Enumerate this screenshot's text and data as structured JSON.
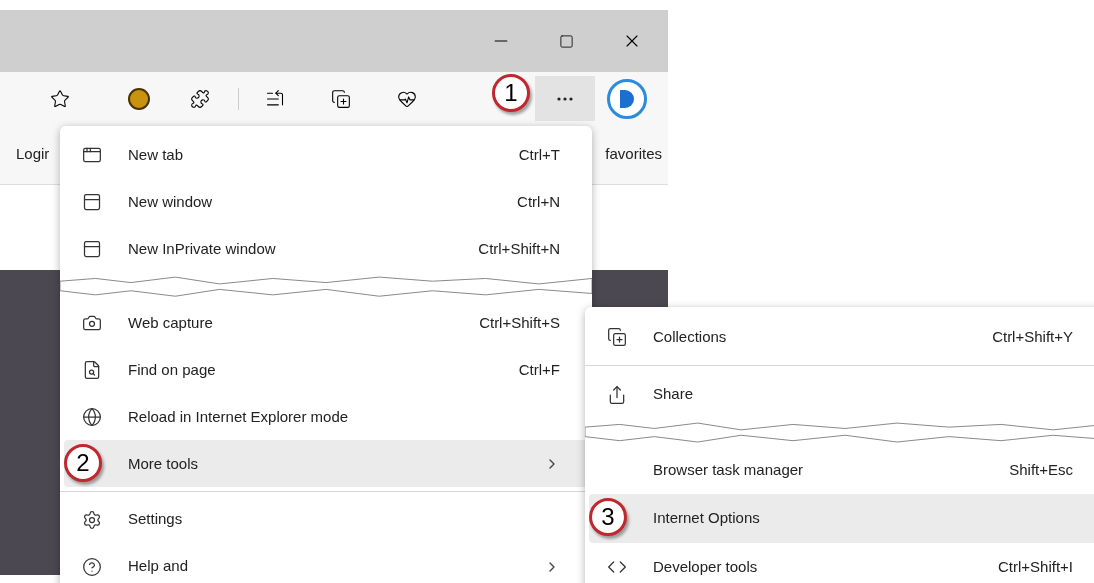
{
  "toolbar": {
    "callout": "1"
  },
  "favorites_bar": {
    "left": "Logir",
    "right": "favorites"
  },
  "main_menu": {
    "items": [
      {
        "kind": "item",
        "label": "New tab",
        "shortcut": "Ctrl+T",
        "selected": false,
        "submenu": false
      },
      {
        "kind": "item",
        "label": "New window",
        "shortcut": "Ctrl+N",
        "selected": false,
        "submenu": false
      },
      {
        "kind": "item",
        "label": "New InPrivate window",
        "shortcut": "Ctrl+Shift+N",
        "selected": false,
        "submenu": false
      },
      {
        "kind": "tear"
      },
      {
        "kind": "item",
        "label": "Web capture",
        "shortcut": "Ctrl+Shift+S",
        "selected": false,
        "submenu": false
      },
      {
        "kind": "item",
        "label": "Find on page",
        "shortcut": "Ctrl+F",
        "selected": false,
        "submenu": false
      },
      {
        "kind": "item",
        "label": "Reload in Internet Explorer mode",
        "selected": false,
        "submenu": false
      },
      {
        "kind": "item",
        "label": "More tools",
        "selected": true,
        "submenu": true,
        "callout": "2"
      },
      {
        "kind": "divider"
      },
      {
        "kind": "item",
        "label": "Settings",
        "selected": false,
        "submenu": false
      },
      {
        "kind": "item",
        "label": "Help and",
        "selected": false,
        "submenu": true
      }
    ]
  },
  "submenu": {
    "items": [
      {
        "kind": "item",
        "label": "Collections",
        "shortcut": "Ctrl+Shift+Y",
        "selected": false
      },
      {
        "kind": "divider"
      },
      {
        "kind": "item",
        "label": "Share",
        "selected": false
      },
      {
        "kind": "tear"
      },
      {
        "kind": "item",
        "label": "Browser task manager",
        "shortcut": "Shift+Esc",
        "selected": false
      },
      {
        "kind": "item",
        "label": "Internet Options",
        "selected": true,
        "callout": "3"
      },
      {
        "kind": "item",
        "label": "Developer tools",
        "shortcut": "Ctrl+Shift+I",
        "selected": false
      }
    ]
  }
}
